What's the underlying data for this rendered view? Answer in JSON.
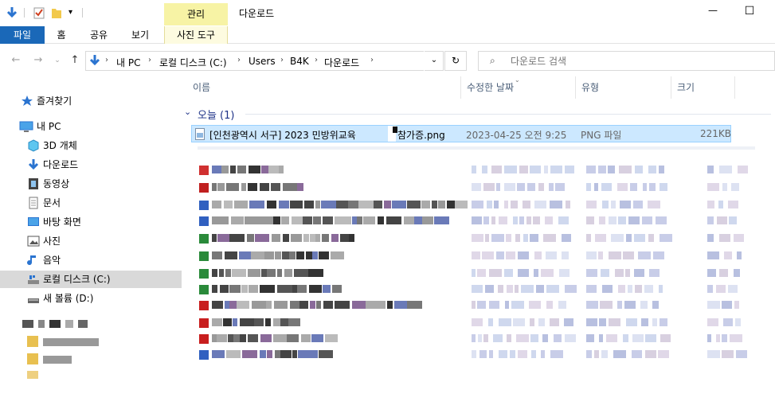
{
  "window": {
    "title": "다운로드",
    "manage_tab": "관리",
    "minimize": "—",
    "maximize": "☐"
  },
  "ribbon": {
    "tabs": [
      "파일",
      "홈",
      "공유",
      "보기",
      "사진 도구"
    ]
  },
  "address": {
    "crumbs": [
      "내 PC",
      "로컬 디스크 (C:)",
      "Users",
      "B4K",
      "다운로드"
    ],
    "separator": "›",
    "dropdown": "⌄",
    "refresh": "↻"
  },
  "search": {
    "placeholder": "다운로드 검색"
  },
  "sidebar": {
    "items": [
      {
        "label": "즐겨찾기",
        "icon": "star-icon"
      },
      {
        "label": "내 PC",
        "icon": "computer-icon"
      },
      {
        "label": "3D 개체",
        "icon": "cube-3d-icon"
      },
      {
        "label": "다운로드",
        "icon": "download-arrow-icon"
      },
      {
        "label": "동영상",
        "icon": "film-icon"
      },
      {
        "label": "문서",
        "icon": "document-icon"
      },
      {
        "label": "바탕 화면",
        "icon": "desktop-icon"
      },
      {
        "label": "사진",
        "icon": "pictures-icon"
      },
      {
        "label": "음악",
        "icon": "music-note-icon"
      },
      {
        "label": "로컬 디스크 (C:)",
        "icon": "drive-c-icon"
      },
      {
        "label": "새 볼륨 (D:)",
        "icon": "drive-d-icon"
      }
    ]
  },
  "columns": {
    "name": "이름",
    "modified": "수정한 날짜",
    "type": "유형",
    "size": "크기"
  },
  "group": {
    "label": "오늘 (1)"
  },
  "selected_file": {
    "name_part1": "[인천광역시 서구] 2023 민방위교육",
    "name_part2": "참가증.png",
    "modified": "2023-04-25 오전 9:25",
    "type": "PNG 파일",
    "size": "221KB"
  },
  "colors": {
    "accent": "#1a68b8",
    "selection": "#cce8ff",
    "selection_border": "#99d1ff",
    "manage_tab": "#f7f3a5"
  }
}
